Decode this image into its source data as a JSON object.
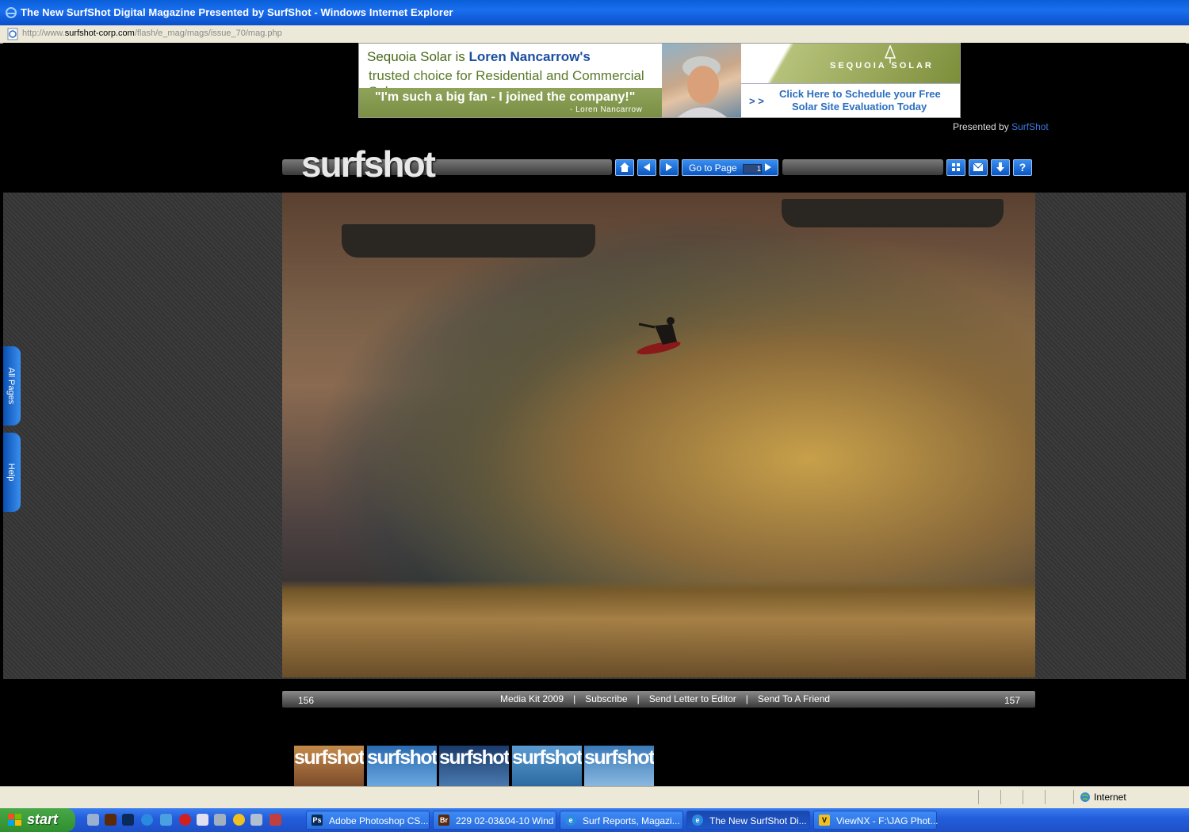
{
  "window": {
    "title": "The New SurfShot Digital Magazine Presented by SurfShot - Windows Internet Explorer"
  },
  "address": {
    "prefix": "http://www.",
    "domain": "surfshot-corp.com",
    "path": "/flash/e_mag/mags/issue_70/mag.php"
  },
  "ad": {
    "line1_pre": "Sequoia Solar is ",
    "line1_name": "Loren Nancarrow's",
    "line2": "trusted choice for Residential and Commercial Solar",
    "quote": "\"I'm such a big fan - I joined the company!\"",
    "attribution": "- Loren Nancarrow",
    "brand": "SEQUOIA SOLAR",
    "cta_arrows": "> >",
    "cta_line1": "Click Here to Schedule your Free",
    "cta_line2": "Solar Site Evaluation Today"
  },
  "presented": {
    "label": "Presented by",
    "link": "SurfShot"
  },
  "toolbar": {
    "logo": "surfshot",
    "goto_label": "Go to Page",
    "page_value": "1"
  },
  "side_tabs": {
    "all_pages": "All Pages",
    "help": "Help"
  },
  "footer": {
    "page_left": "156",
    "page_right": "157",
    "links": [
      "Media Kit 2009",
      "Subscribe",
      "Send Letter to Editor",
      "Send To A Friend"
    ],
    "separator": "|"
  },
  "thumbnails": [
    "surfshot",
    "surfshot",
    "surfshot",
    "surfshot",
    "surfshot"
  ],
  "status": {
    "zone": "Internet"
  },
  "taskbar": {
    "start": "start",
    "tasks": [
      {
        "label": "Adobe Photoshop CS...",
        "icon": "Ps"
      },
      {
        "label": "229 02-03&04-10 Wind",
        "icon": "Br"
      },
      {
        "label": "Surf Reports, Magazi...",
        "icon": "e"
      },
      {
        "label": "The New SurfShot Di...",
        "icon": "e"
      },
      {
        "label": "ViewNX - F:\\JAG Phot...",
        "icon": "V"
      }
    ]
  },
  "colors": {
    "accent": "#0a55c0",
    "link": "#3a78e0",
    "taskbar": "#245edb"
  }
}
